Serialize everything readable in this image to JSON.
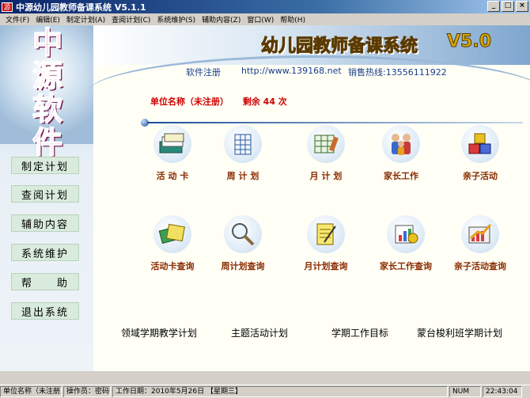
{
  "window": {
    "title": "中源幼儿园教师备课系统  V5.1.1",
    "app_icon": "源",
    "minimize": "_",
    "maximize": "□",
    "close": "×"
  },
  "menu": [
    "文件(F)",
    "编辑(E)",
    "制定计划(A)",
    "查阅计划(C)",
    "系统维护(S)",
    "辅助内容(Z)",
    "窗口(W)",
    "帮助(H)"
  ],
  "logo": [
    "中",
    "源",
    "软",
    "件"
  ],
  "nav": [
    "制定计划",
    "查阅计划",
    "辅助内容",
    "系统维护",
    "帮　　助",
    "退出系统"
  ],
  "banner": {
    "title": "幼儿园教师备课系统",
    "version": "V5.0"
  },
  "info": {
    "register": "软件注册",
    "url": "http://www.139168.net",
    "hotline": "销售热线:13556111922"
  },
  "org": {
    "name": "单位名称（未注册）",
    "remaining": "剩余 44 次"
  },
  "features": [
    {
      "label": "活 动 卡",
      "icon": "activity-card-icon"
    },
    {
      "label": "周 计 划",
      "icon": "weekly-plan-icon"
    },
    {
      "label": "月 计 划",
      "icon": "monthly-plan-icon"
    },
    {
      "label": "家长工作",
      "icon": "parents-icon"
    },
    {
      "label": "亲子活动",
      "icon": "blocks-icon"
    },
    {
      "label": "活动卡查询",
      "icon": "card-search-icon"
    },
    {
      "label": "周计划查询",
      "icon": "magnifier-icon"
    },
    {
      "label": "月计划查询",
      "icon": "notepad-icon"
    },
    {
      "label": "家长工作查询",
      "icon": "report-icon"
    },
    {
      "label": "亲子活动查询",
      "icon": "chart-icon"
    }
  ],
  "plans": [
    "领域学期教学计划",
    "主题活动计划",
    "学期工作目标",
    "蒙台梭利班学期计划"
  ],
  "status": {
    "unit": "单位名称（未注册）",
    "operator": "操作员：密码*",
    "date": "工作日期：2010年5月26日  【星期三】",
    "num": "NUM",
    "time": "22:43:04"
  },
  "colors": {
    "titlebar": "#0a246a",
    "nav_button": "#d9ebdc",
    "accent_red": "#d00000",
    "label_brown": "#8a2b00"
  }
}
